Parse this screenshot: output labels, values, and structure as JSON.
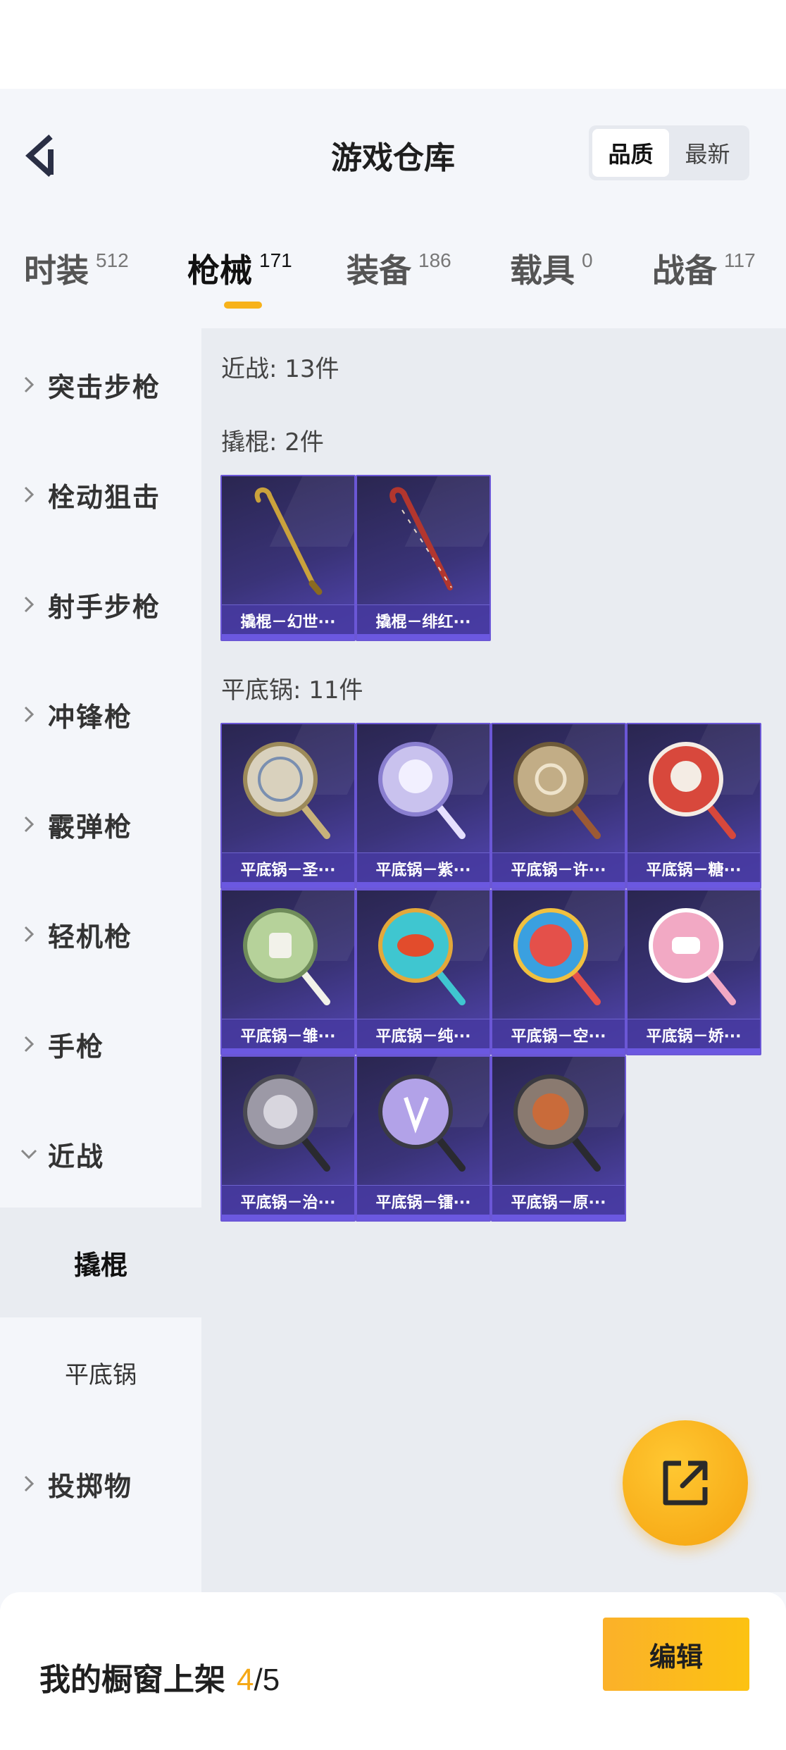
{
  "header": {
    "title": "游戏仓库",
    "sort_options": [
      "品质",
      "最新"
    ],
    "sort_active": "品质"
  },
  "tabs": [
    {
      "label": "时装",
      "count": "512"
    },
    {
      "label": "枪械",
      "count": "171",
      "active": true
    },
    {
      "label": "装备",
      "count": "186"
    },
    {
      "label": "载具",
      "count": "0"
    },
    {
      "label": "战备",
      "count": "117"
    }
  ],
  "sidebar": {
    "items": [
      {
        "label": "突击步枪"
      },
      {
        "label": "栓动狙击"
      },
      {
        "label": "射手步枪"
      },
      {
        "label": "冲锋枪"
      },
      {
        "label": "霰弹枪"
      },
      {
        "label": "轻机枪"
      },
      {
        "label": "手枪"
      },
      {
        "label": "近战",
        "expanded": true
      },
      {
        "label": "投掷物"
      }
    ],
    "sub_items": [
      {
        "label": "撬棍",
        "active": true
      },
      {
        "label": "平底锅"
      }
    ]
  },
  "content": {
    "category_title": "近战: 13件",
    "groups": [
      {
        "title": "撬棍: 2件",
        "items": [
          {
            "name": "撬棍－幻世···",
            "icon": "crowbar-gold-icon",
            "color": "#caa23c"
          },
          {
            "name": "撬棍－绯红···",
            "icon": "crowbar-red-icon",
            "color": "#b2362e"
          }
        ]
      },
      {
        "title": "平底锅: 11件",
        "items": [
          {
            "name": "平底锅－圣···",
            "icon": "pan-holy-icon",
            "color": "#d9d1bd"
          },
          {
            "name": "平底锅－紫···",
            "icon": "pan-purple-icon",
            "color": "#c9c2ee"
          },
          {
            "name": "平底锅－许···",
            "icon": "pan-wish-icon",
            "color": "#c2ad86"
          },
          {
            "name": "平底锅－糖···",
            "icon": "pan-candy-icon",
            "color": "#d8483c"
          },
          {
            "name": "平底锅－雏···",
            "icon": "pan-chick-icon",
            "color": "#b6d29a"
          },
          {
            "name": "平底锅－纯···",
            "icon": "pan-pure-icon",
            "color": "#3fc6d0"
          },
          {
            "name": "平底锅－空···",
            "icon": "pan-sky-icon",
            "color": "#e4504a"
          },
          {
            "name": "平底锅－娇···",
            "icon": "pan-sweet-icon",
            "color": "#f2a9c4"
          },
          {
            "name": "平底锅－治···",
            "icon": "pan-heal-icon",
            "color": "#9c99a6"
          },
          {
            "name": "平底锅－镭···",
            "icon": "pan-laser-icon",
            "color": "#b2a2e8"
          },
          {
            "name": "平底锅－原···",
            "icon": "pan-origin-icon",
            "color": "#c96b3a"
          }
        ]
      }
    ]
  },
  "fab": {
    "icon": "share-external-icon",
    "color": "#f7b21a"
  },
  "bottom": {
    "label": "我的橱窗上架",
    "current": "4",
    "slash": "/",
    "total": "5",
    "edit_label": "编辑"
  }
}
